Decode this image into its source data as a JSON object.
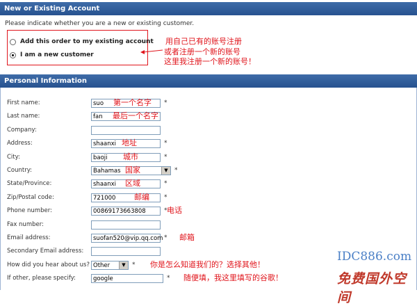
{
  "account": {
    "header": "New or Existing Account",
    "instruction": "Please indicate whether you are a new or existing customer.",
    "options": [
      {
        "label": "Add this order to my existing account",
        "checked": false
      },
      {
        "label": "I am a new customer",
        "checked": true
      }
    ],
    "annotation": [
      "用自己已有的账号注册",
      "或者注册一个新的账号",
      "这里我注册一个新的账号！"
    ]
  },
  "personal": {
    "header": "Personal Information",
    "fields": [
      {
        "label": "First name:",
        "value": "suo",
        "required": true,
        "note": "第一个名字"
      },
      {
        "label": "Last name:",
        "value": "fan",
        "required": false,
        "note": "最后一个名字"
      },
      {
        "label": "Company:",
        "value": "",
        "required": false,
        "note": ""
      },
      {
        "label": "Address:",
        "value": "shaanxi",
        "required": true,
        "note": "地址"
      },
      {
        "label": "City:",
        "value": "baoji",
        "required": true,
        "note": "城市"
      },
      {
        "label": "Country:",
        "value": "Bahamas",
        "required": true,
        "note": "国家",
        "type": "select"
      },
      {
        "label": "State/Province:",
        "value": "shaanxi",
        "required": true,
        "note": "区域"
      },
      {
        "label": "Zip/Postal code:",
        "value": "721000",
        "required": true,
        "note": "邮编"
      },
      {
        "label": "Phone number:",
        "value": "00869173663808",
        "required": true,
        "note": "电话"
      },
      {
        "label": "Fax number:",
        "value": "",
        "required": false,
        "note": ""
      },
      {
        "label": "Email address:",
        "value": "suofan520@vip.qq.com",
        "required": true,
        "note": "邮箱"
      },
      {
        "label": "Secondary Email address:",
        "value": "",
        "required": false,
        "note": ""
      },
      {
        "label": "How did you hear about us?",
        "value": "Other",
        "required": true,
        "note": "你是怎么知道我们的？选择其他！",
        "type": "select"
      },
      {
        "label": "If other, please specify:",
        "value": "google",
        "required": true,
        "note": "随便填，我这里填写的谷歌！"
      }
    ]
  },
  "watermark": {
    "line1": "IDC886.com",
    "line2": "免费国外空间"
  }
}
